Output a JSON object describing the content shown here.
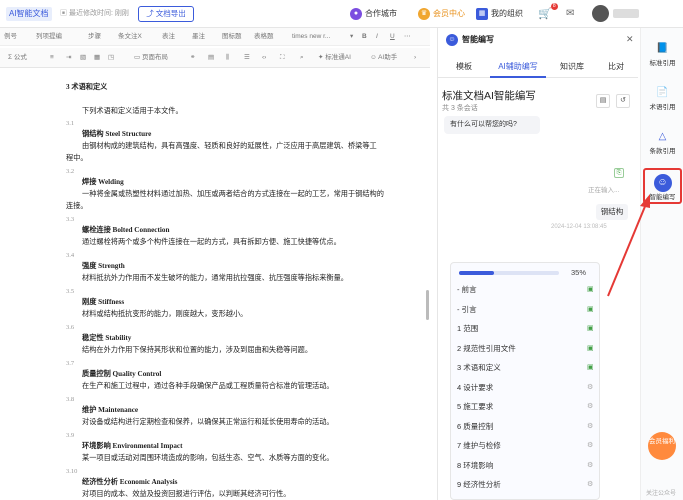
{
  "topbar": {
    "app_label": "AI智能文档",
    "last_save": "最近修改时间: 刚刚",
    "export_label": "文档导出",
    "city_label": "合作城市",
    "vip_label": "会员中心",
    "org_label": "我的组织",
    "cart_badge": "8"
  },
  "toolbar": {
    "row1": [
      "例号",
      "列项提编",
      "步骤",
      "条文注X",
      "表注",
      "墨注",
      "图标题",
      "表格题",
      "times new r..."
    ],
    "row2": [
      "公式",
      "|",
      "页面布局",
      "",
      "标准通AI",
      "AI助手"
    ]
  },
  "doc": {
    "section_title": "3  术语和定义",
    "intro": "下列术语和定义适用于本文件。",
    "entries": [
      {
        "num": "3.1",
        "term": "钢结构  Steel Structure",
        "def": [
          "由钢材构成的建筑结构，具有高强度、轻质和良好的延展性，广泛应用于高层建筑、桥梁等工",
          "程中。"
        ]
      },
      {
        "num": "3.2",
        "term": "焊接  Welding",
        "def": [
          "一种将金属或热塑性材料通过加热、加压或两者结合的方式连接在一起的工艺，常用于钢结构的",
          "连接。"
        ]
      },
      {
        "num": "3.3",
        "term": "螺栓连接  Bolted Connection",
        "def": [
          "通过螺栓将两个或多个构件连接在一起的方式，具有拆卸方便、施工快捷等优点。"
        ]
      },
      {
        "num": "3.4",
        "term": "强度  Strength",
        "def": [
          "材料抵抗外力作用而不发生破坏的能力，通常用抗拉强度、抗压强度等指标来衡量。"
        ]
      },
      {
        "num": "3.5",
        "term": "刚度  Stiffness",
        "def": [
          "材料或结构抵抗变形的能力，刚度越大，变形越小。"
        ]
      },
      {
        "num": "3.6",
        "term": "稳定性  Stability",
        "def": [
          "结构在外力作用下保持其形状和位置的能力，涉及到屈曲和失稳等问题。"
        ]
      },
      {
        "num": "3.7",
        "term": "质量控制  Quality Control",
        "def": [
          "在生产和施工过程中，通过各种手段确保产品或工程质量符合标准的管理活动。"
        ]
      },
      {
        "num": "3.8",
        "term": "维护  Maintenance",
        "def": [
          "对设备或结构进行定期检查和保养，以确保其正常运行和延长使用寿命的活动。"
        ]
      },
      {
        "num": "3.9",
        "term": "环境影响  Environmental Impact",
        "def": [
          "某一项目或活动对周围环境造成的影响，包括生态、空气、水质等方面的变化。"
        ]
      },
      {
        "num": "3.10",
        "term": "经济性分析  Economic Analysis",
        "def": [
          "对项目的成本、效益及投资回报进行评估，以判断其经济可行性。"
        ]
      }
    ]
  },
  "panel": {
    "title": "智能编写",
    "tabs": [
      "模板",
      "AI辅助编写",
      "知识库",
      "比对"
    ],
    "heading": "标准文档AI智能编写",
    "sub": "共 3 条会话",
    "bot_msg": "有什么可以帮您的吗?",
    "status": "正在输入...",
    "user_msg": "钢结构",
    "timestamp": "2024-12-04 13:08:45",
    "progress_text": "35%",
    "progress": 0.35,
    "outline": [
      {
        "label": "- 前言",
        "done": true
      },
      {
        "label": "- 引言",
        "done": true
      },
      {
        "label": "1 范围",
        "done": true
      },
      {
        "label": "2 规范性引用文件",
        "done": true
      },
      {
        "label": "3 术语和定义",
        "done": true
      },
      {
        "label": "4 设计要求",
        "done": false
      },
      {
        "label": "5 施工要求",
        "done": false
      },
      {
        "label": "6 质量控制",
        "done": false
      },
      {
        "label": "7 维护与检修",
        "done": false
      },
      {
        "label": "8 环境影响",
        "done": false
      },
      {
        "label": "9 经济性分析",
        "done": false
      }
    ]
  },
  "rail": {
    "items": [
      "标准引用",
      "术语引用",
      "条款引用",
      "智能编写"
    ],
    "promo": "会员福利",
    "bottom": "关注公众号"
  }
}
